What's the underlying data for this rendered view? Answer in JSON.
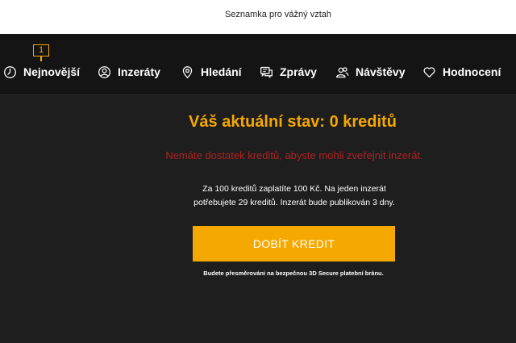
{
  "header": {
    "site_title": "Seznamka pro vážný vztah"
  },
  "nav": {
    "items": [
      {
        "label": "Nejnovější",
        "icon": "clock-icon",
        "badge": "1"
      },
      {
        "label": "Inzeráty",
        "icon": "user-icon"
      },
      {
        "label": "Hledání",
        "icon": "location-pin-icon"
      },
      {
        "label": "Zprávy",
        "icon": "chat-icon"
      },
      {
        "label": "Návštěvy",
        "icon": "users-icon"
      },
      {
        "label": "Hodnocení",
        "icon": "heart-icon"
      }
    ]
  },
  "main": {
    "status_heading": "Váš aktuální stav: 0 kreditů",
    "error_text": "Nemáte dostatek kreditů, abyste mohli zveřejnit inzerát.",
    "info_line1": "Za 100 kreditů zaplatíte 100 Kč. Na jeden inzerát",
    "info_line2": "potřebujete 29 kreditů. Inzerát bude publikován 3 dny.",
    "topup_button_label": "DOBÍT KREDIT",
    "redirect_note": "Budete přesměrováni na bezpečnou 3D Secure platební bránu."
  },
  "colors": {
    "accent": "#f5a800",
    "error": "#b22222",
    "background": "#1e1e1e",
    "navbar": "#141414"
  }
}
